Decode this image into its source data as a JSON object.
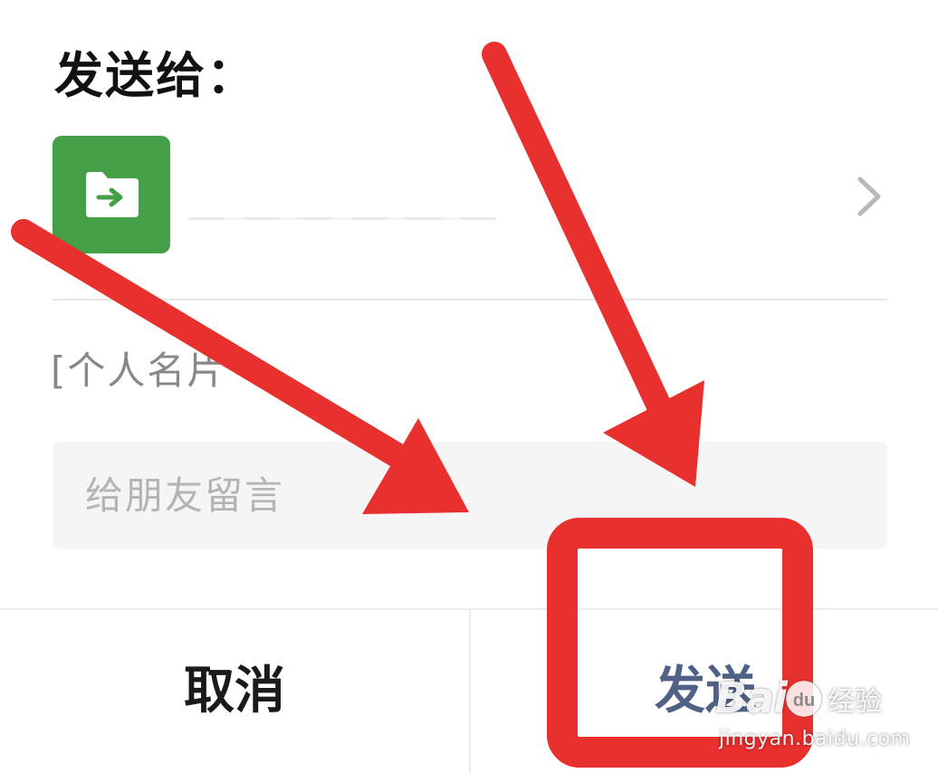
{
  "dialog": {
    "title": "发送给：",
    "recipient": {
      "name": "",
      "avatar_icon": "folder-transfer-icon",
      "avatar_color": "#43a047"
    },
    "content_preview": "[个人名片",
    "message": {
      "value": "",
      "placeholder": "给朋友留言"
    },
    "buttons": {
      "cancel_label": "取消",
      "send_label": "发送"
    }
  },
  "annotations": {
    "color": "#e8302e",
    "highlight_target": "send-button"
  },
  "watermark": {
    "brand": "Bai",
    "brand_suffix": "du",
    "product": "经验",
    "url": "jingyan.baidu.com"
  },
  "colors": {
    "send_text": "#4f6285",
    "cancel_text": "#1a1a1a",
    "input_bg": "#f5f5f5"
  }
}
